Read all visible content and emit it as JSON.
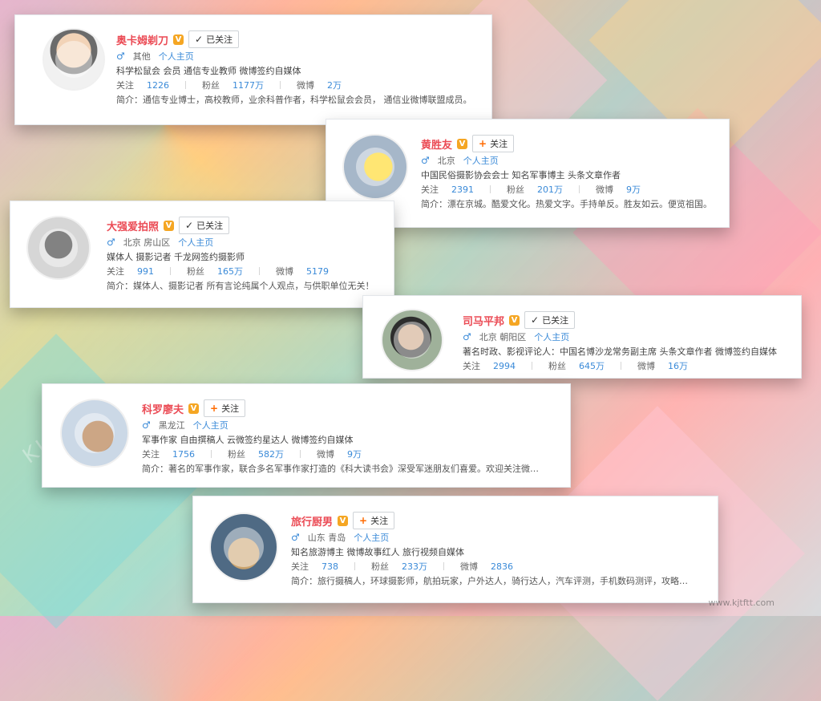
{
  "cards": [
    {
      "name": "奥卡姆剃刀",
      "follow": "已关注",
      "location": "其他",
      "home": "个人主页",
      "tags": "科学松鼠会 会员 通信专业教师 微博签约自媒体",
      "stats": {
        "following": "1226",
        "fans": "1177万",
        "posts": "2万"
      },
      "bio": "简介：通信专业博士，高校教师，业余科普作者，科学松鼠会会员， 通信业微博联盟成员。",
      "labels": {
        "following": "关注",
        "fans": "粉丝",
        "posts": "微博"
      }
    },
    {
      "name": "黄胜友",
      "follow": "关注",
      "location": "北京",
      "home": "个人主页",
      "tags": "中国民俗摄影协会会士 知名军事博主 头条文章作者",
      "stats": {
        "following": "2391",
        "fans": "201万",
        "posts": "9万"
      },
      "bio": "简介：漂在京城。酷爱文化。热爱文字。手持单反。胜友如云。便览祖国。",
      "labels": {
        "following": "关注",
        "fans": "粉丝",
        "posts": "微博"
      }
    },
    {
      "name": "大强爱拍照",
      "follow": "已关注",
      "location": "北京 房山区",
      "home": "个人主页",
      "tags": "媒体人 摄影记者 千龙网签约摄影师",
      "stats": {
        "following": "991",
        "fans": "165万",
        "posts": "5179"
      },
      "bio": "简介：媒体人、摄影记者 所有言论纯属个人观点，与供职单位无关！",
      "labels": {
        "following": "关注",
        "fans": "粉丝",
        "posts": "微博"
      }
    },
    {
      "name": "司马平邦",
      "follow": "已关注",
      "location": "北京 朝阳区",
      "home": "个人主页",
      "tags": "著名时政、影视评论人：中国名博沙龙常务副主席 头条文章作者 微博签约自媒体",
      "stats": {
        "following": "2994",
        "fans": "645万",
        "posts": "16万"
      },
      "bio": "",
      "labels": {
        "following": "关注",
        "fans": "粉丝",
        "posts": "微博"
      }
    },
    {
      "name": "科罗廖夫",
      "follow": "关注",
      "location": "黑龙江",
      "home": "个人主页",
      "tags": "军事作家 自由撰稿人 云微签约星达人 微博签约自媒体",
      "stats": {
        "following": "1756",
        "fans": "582万",
        "posts": "9万"
      },
      "bio": "简介：著名的军事作家，联合多名军事作家打造的《科大读书会》深受军迷朋友们喜爱。欢迎关注微…",
      "labels": {
        "following": "关注",
        "fans": "粉丝",
        "posts": "微博"
      }
    },
    {
      "name": "旅行厨男",
      "follow": "关注",
      "location": "山东 青岛",
      "home": "个人主页",
      "tags": "知名旅游博主 微博故事红人 旅行视频自媒体",
      "stats": {
        "following": "738",
        "fans": "233万",
        "posts": "2836"
      },
      "bio": "简介：旅行摄稿人，环球摄影师，航拍玩家，户外达人，骑行达人，汽车评测，手机数码测评，攻略…",
      "labels": {
        "following": "关注",
        "fans": "粉丝",
        "posts": "微博"
      }
    }
  ],
  "watermark": "www.kjtftt.com",
  "diag_watermark": "KIDS ME"
}
